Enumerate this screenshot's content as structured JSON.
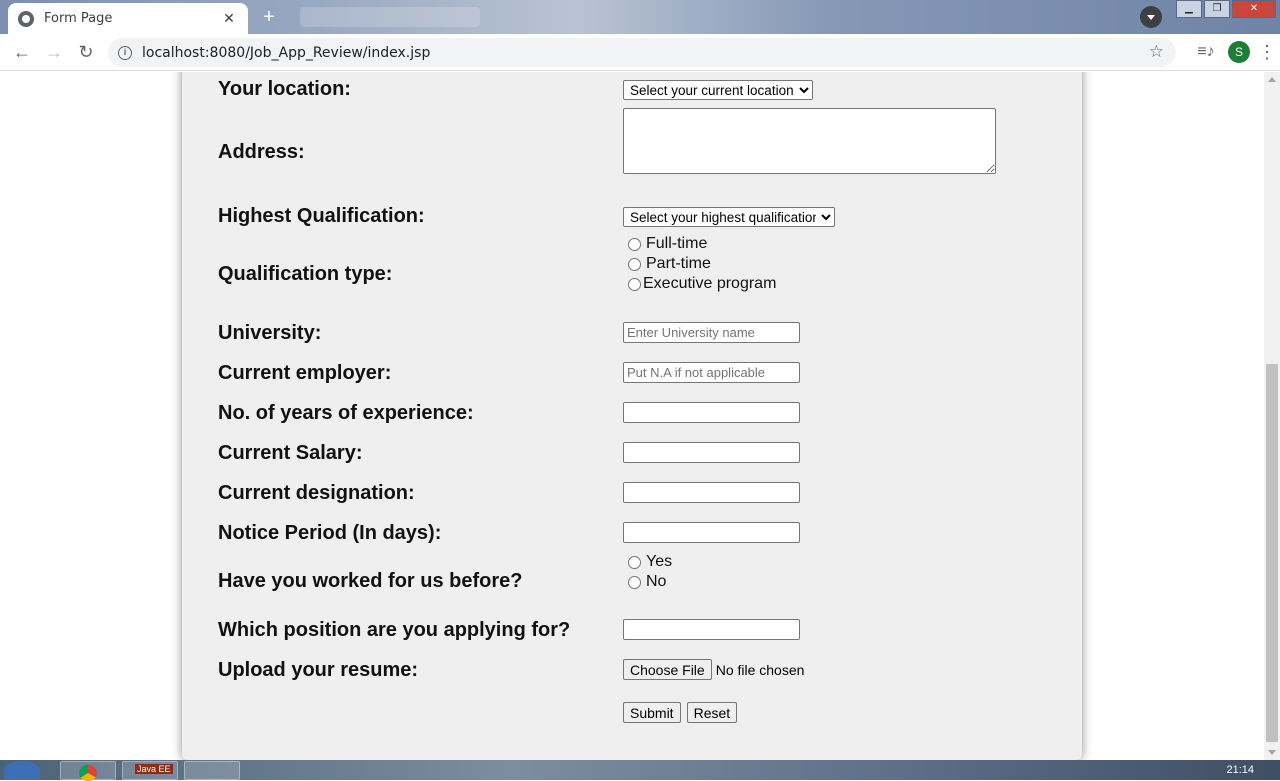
{
  "browser": {
    "tab_title": "Form Page",
    "tab_close": "✕",
    "new_tab": "+",
    "url": "localhost:8080/Job_App_Review/index.jsp",
    "avatar_letter": "S",
    "back": "←",
    "forward": "→",
    "reload": "↻",
    "info": "i",
    "star": "☆",
    "menu": "⋮",
    "media": "≡♪"
  },
  "form": {
    "location": {
      "label": "Your location:",
      "selected": "Select your current location:"
    },
    "address": {
      "label": "Address:"
    },
    "qualification": {
      "label": "Highest Qualification:",
      "selected": "Select your highest qualification"
    },
    "qualification_type": {
      "label": "Qualification type:",
      "options": [
        "Full-time",
        "Part-time",
        "Executive program"
      ]
    },
    "university": {
      "label": "University:",
      "placeholder": "Enter University name"
    },
    "employer": {
      "label": "Current employer:",
      "placeholder": "Put N.A if not applicable"
    },
    "experience": {
      "label": "No. of years of experience:"
    },
    "salary": {
      "label": "Current Salary:"
    },
    "designation": {
      "label": "Current designation:"
    },
    "notice": {
      "label": "Notice Period (In days):"
    },
    "worked_before": {
      "label": "Have you worked for us before?",
      "options": [
        "Yes",
        "No"
      ]
    },
    "position": {
      "label": "Which position are you applying for?"
    },
    "resume": {
      "label": "Upload your resume:",
      "button": "Choose File",
      "status": "No file chosen"
    },
    "submit": "Submit",
    "reset": "Reset"
  },
  "taskbar": {
    "javaee_label": "Java EE",
    "clock": "21:14"
  }
}
